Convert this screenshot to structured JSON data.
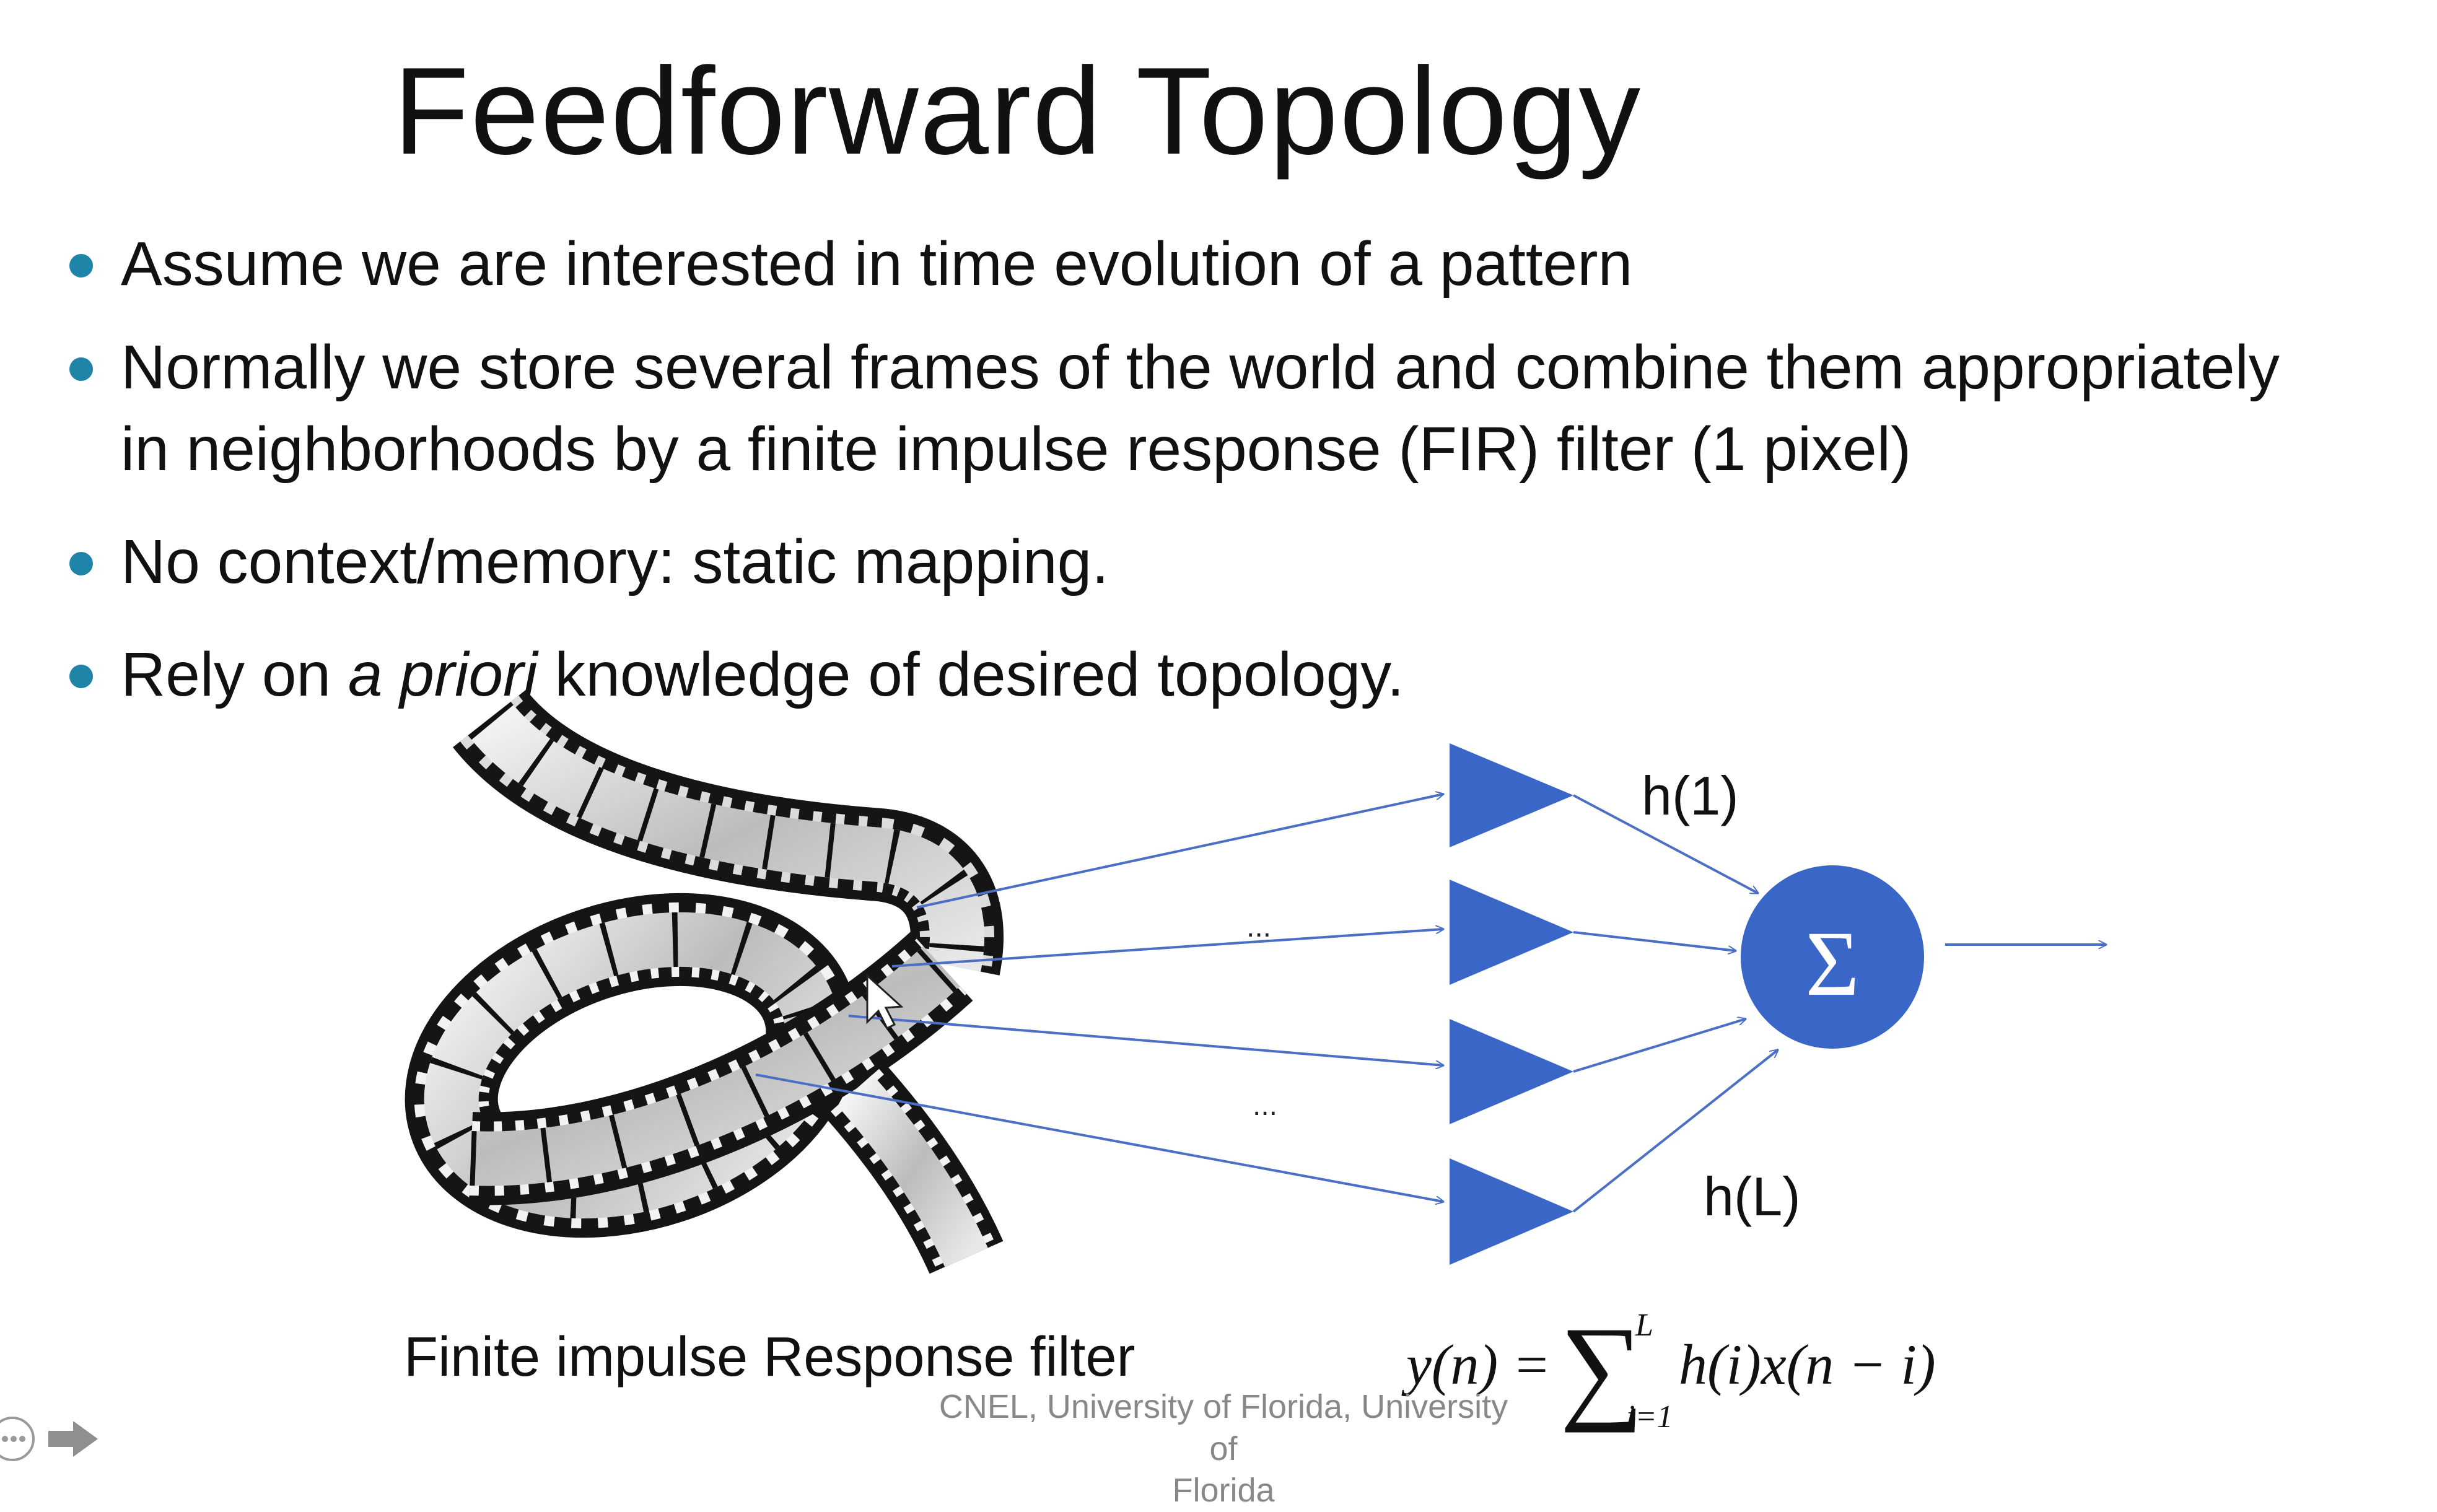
{
  "slide": {
    "title": "Feedforward Topology",
    "bullets": {
      "b1": "Assume we are interested in time evolution of a pattern",
      "b2_line1": "Normally we store several frames of the world and combine them appropriately",
      "b2_line2": "in neighborhoods by a finite impulse response (FIR) filter (1 pixel)",
      "b3": "No context/memory: static mapping.",
      "b4_pre": "Rely on ",
      "b4_em": "a priori",
      "b4_post": " knowledge of desired topology."
    }
  },
  "diagram": {
    "tap_top_label": "h(1)",
    "tap_bottom_label": "h(L)",
    "sum_symbol": "Σ",
    "ellipsis_upper": "...",
    "ellipsis_lower": "...",
    "colors": {
      "accent": "#3a66c8",
      "line": "#4a6fc4",
      "bullet": "#1e84a8"
    }
  },
  "caption": "Finite impulse Response filter",
  "formula": {
    "lhs": "y(n) =",
    "sigma": "∑",
    "upper": "L",
    "lower": "i=1",
    "rhs": "h(i)x(n − i)"
  },
  "footer": {
    "line1": "CNEL, University of Florida, University of",
    "line2": "Florida"
  },
  "icons": {
    "film_strip": "film-strip-icon",
    "nav_more": "more-options-icon",
    "nav_next": "next-arrow-icon"
  }
}
